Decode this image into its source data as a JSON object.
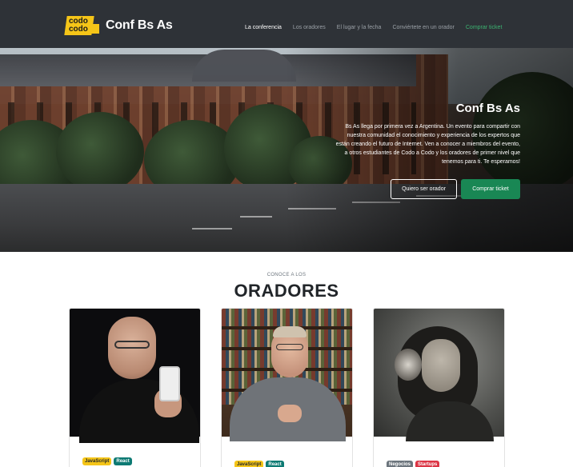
{
  "brand": {
    "logo_line1": "codo",
    "logo_line2": "codo",
    "title": "Conf Bs As"
  },
  "nav": {
    "items": [
      {
        "label": "La conferencia",
        "state": "active"
      },
      {
        "label": "Los oradores",
        "state": "normal"
      },
      {
        "label": "El lugar y la fecha",
        "state": "normal"
      },
      {
        "label": "Conviértete en un orador",
        "state": "normal"
      },
      {
        "label": "Comprar ticket",
        "state": "highlight"
      }
    ]
  },
  "hero": {
    "title": "Conf Bs As",
    "text": "Bs As llega por primera vez a Argentina. Un evento para compartir con nuestra comunidad el conocimiento y experiencia de los expertos que están creando el futuro de Internet. Ven a conocer a miembros del evento, a otros estudiantes de Codo a Codo y los oradores de primer nivel que tenemos para ti. Te esperamos!",
    "btn_speaker": "Quiero ser orador",
    "btn_ticket": "Comprar ticket"
  },
  "speakers": {
    "kicker": "CONOCE A LOS",
    "title": "ORADORES",
    "cards": [
      {
        "badges": [
          {
            "label": "JavaScript",
            "color": "#f5c518"
          },
          {
            "label": "React",
            "color": "#0d7a73"
          }
        ]
      },
      {
        "badges": [
          {
            "label": "JavaScript",
            "color": "#f5c518"
          },
          {
            "label": "React",
            "color": "#0d7a73"
          }
        ]
      },
      {
        "badges": [
          {
            "label": "Negocios",
            "color": "#6c757d"
          },
          {
            "label": "Startups",
            "color": "#dc3545"
          }
        ]
      }
    ]
  },
  "colors": {
    "navbar": "#2e3237",
    "accent_green": "#198754",
    "accent_yellow": "#f5c518"
  }
}
